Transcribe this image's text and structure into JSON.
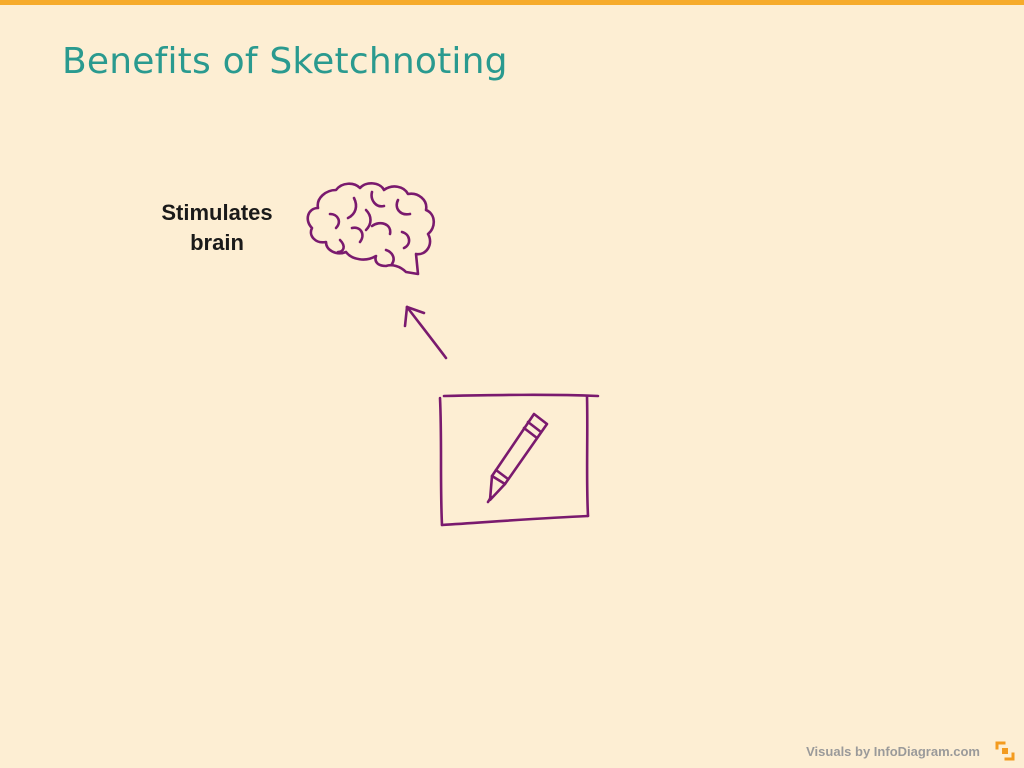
{
  "slide": {
    "title": "Benefits of Sketchnoting",
    "benefit_label": "Stimulates brain",
    "footer_credit": "Visuals by InfoDiagram.com"
  },
  "colors": {
    "background": "#fdeed3",
    "top_bar": "#f6ab2c",
    "title": "#2a9a8f",
    "sketch_stroke": "#7a1a6e",
    "footer_text": "#9a9a9a",
    "logo": "#f39b1f"
  },
  "icons": [
    "brain-icon",
    "arrow-icon",
    "pencil-icon",
    "frame-icon",
    "infodiagram-logo-icon"
  ]
}
